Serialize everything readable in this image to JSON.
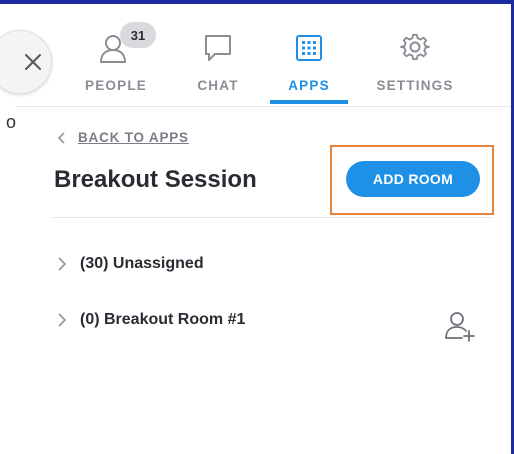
{
  "tabs": [
    {
      "label": "PEOPLE",
      "icon": "people-icon",
      "badge": "31",
      "active": false
    },
    {
      "label": "CHAT",
      "icon": "chat-icon",
      "active": false
    },
    {
      "label": "APPS",
      "icon": "apps-grid-icon",
      "active": true
    },
    {
      "label": "SETTINGS",
      "icon": "settings-gear-icon",
      "active": false
    }
  ],
  "back_link": "BACK TO APPS",
  "title": "Breakout Session",
  "add_room_label": "ADD ROOM",
  "rooms": [
    {
      "label": "(30) Unassigned"
    },
    {
      "label": "(0) Breakout Room #1"
    }
  ],
  "colors": {
    "accent": "#1e90e6",
    "highlight": "#e8843a",
    "frame": "#1c2aa0"
  }
}
